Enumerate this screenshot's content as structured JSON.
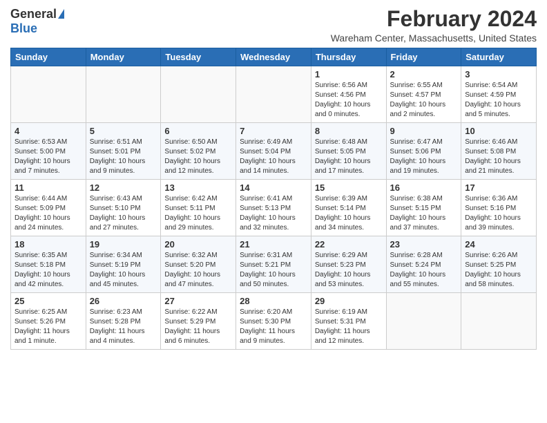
{
  "header": {
    "logo_general": "General",
    "logo_blue": "Blue",
    "month_title": "February 2024",
    "location": "Wareham Center, Massachusetts, United States"
  },
  "calendar": {
    "days_of_week": [
      "Sunday",
      "Monday",
      "Tuesday",
      "Wednesday",
      "Thursday",
      "Friday",
      "Saturday"
    ],
    "weeks": [
      [
        {
          "day": "",
          "info": ""
        },
        {
          "day": "",
          "info": ""
        },
        {
          "day": "",
          "info": ""
        },
        {
          "day": "",
          "info": ""
        },
        {
          "day": "1",
          "info": "Sunrise: 6:56 AM\nSunset: 4:56 PM\nDaylight: 10 hours\nand 0 minutes."
        },
        {
          "day": "2",
          "info": "Sunrise: 6:55 AM\nSunset: 4:57 PM\nDaylight: 10 hours\nand 2 minutes."
        },
        {
          "day": "3",
          "info": "Sunrise: 6:54 AM\nSunset: 4:59 PM\nDaylight: 10 hours\nand 5 minutes."
        }
      ],
      [
        {
          "day": "4",
          "info": "Sunrise: 6:53 AM\nSunset: 5:00 PM\nDaylight: 10 hours\nand 7 minutes."
        },
        {
          "day": "5",
          "info": "Sunrise: 6:51 AM\nSunset: 5:01 PM\nDaylight: 10 hours\nand 9 minutes."
        },
        {
          "day": "6",
          "info": "Sunrise: 6:50 AM\nSunset: 5:02 PM\nDaylight: 10 hours\nand 12 minutes."
        },
        {
          "day": "7",
          "info": "Sunrise: 6:49 AM\nSunset: 5:04 PM\nDaylight: 10 hours\nand 14 minutes."
        },
        {
          "day": "8",
          "info": "Sunrise: 6:48 AM\nSunset: 5:05 PM\nDaylight: 10 hours\nand 17 minutes."
        },
        {
          "day": "9",
          "info": "Sunrise: 6:47 AM\nSunset: 5:06 PM\nDaylight: 10 hours\nand 19 minutes."
        },
        {
          "day": "10",
          "info": "Sunrise: 6:46 AM\nSunset: 5:08 PM\nDaylight: 10 hours\nand 21 minutes."
        }
      ],
      [
        {
          "day": "11",
          "info": "Sunrise: 6:44 AM\nSunset: 5:09 PM\nDaylight: 10 hours\nand 24 minutes."
        },
        {
          "day": "12",
          "info": "Sunrise: 6:43 AM\nSunset: 5:10 PM\nDaylight: 10 hours\nand 27 minutes."
        },
        {
          "day": "13",
          "info": "Sunrise: 6:42 AM\nSunset: 5:11 PM\nDaylight: 10 hours\nand 29 minutes."
        },
        {
          "day": "14",
          "info": "Sunrise: 6:41 AM\nSunset: 5:13 PM\nDaylight: 10 hours\nand 32 minutes."
        },
        {
          "day": "15",
          "info": "Sunrise: 6:39 AM\nSunset: 5:14 PM\nDaylight: 10 hours\nand 34 minutes."
        },
        {
          "day": "16",
          "info": "Sunrise: 6:38 AM\nSunset: 5:15 PM\nDaylight: 10 hours\nand 37 minutes."
        },
        {
          "day": "17",
          "info": "Sunrise: 6:36 AM\nSunset: 5:16 PM\nDaylight: 10 hours\nand 39 minutes."
        }
      ],
      [
        {
          "day": "18",
          "info": "Sunrise: 6:35 AM\nSunset: 5:18 PM\nDaylight: 10 hours\nand 42 minutes."
        },
        {
          "day": "19",
          "info": "Sunrise: 6:34 AM\nSunset: 5:19 PM\nDaylight: 10 hours\nand 45 minutes."
        },
        {
          "day": "20",
          "info": "Sunrise: 6:32 AM\nSunset: 5:20 PM\nDaylight: 10 hours\nand 47 minutes."
        },
        {
          "day": "21",
          "info": "Sunrise: 6:31 AM\nSunset: 5:21 PM\nDaylight: 10 hours\nand 50 minutes."
        },
        {
          "day": "22",
          "info": "Sunrise: 6:29 AM\nSunset: 5:23 PM\nDaylight: 10 hours\nand 53 minutes."
        },
        {
          "day": "23",
          "info": "Sunrise: 6:28 AM\nSunset: 5:24 PM\nDaylight: 10 hours\nand 55 minutes."
        },
        {
          "day": "24",
          "info": "Sunrise: 6:26 AM\nSunset: 5:25 PM\nDaylight: 10 hours\nand 58 minutes."
        }
      ],
      [
        {
          "day": "25",
          "info": "Sunrise: 6:25 AM\nSunset: 5:26 PM\nDaylight: 11 hours\nand 1 minute."
        },
        {
          "day": "26",
          "info": "Sunrise: 6:23 AM\nSunset: 5:28 PM\nDaylight: 11 hours\nand 4 minutes."
        },
        {
          "day": "27",
          "info": "Sunrise: 6:22 AM\nSunset: 5:29 PM\nDaylight: 11 hours\nand 6 minutes."
        },
        {
          "day": "28",
          "info": "Sunrise: 6:20 AM\nSunset: 5:30 PM\nDaylight: 11 hours\nand 9 minutes."
        },
        {
          "day": "29",
          "info": "Sunrise: 6:19 AM\nSunset: 5:31 PM\nDaylight: 11 hours\nand 12 minutes."
        },
        {
          "day": "",
          "info": ""
        },
        {
          "day": "",
          "info": ""
        }
      ]
    ]
  }
}
